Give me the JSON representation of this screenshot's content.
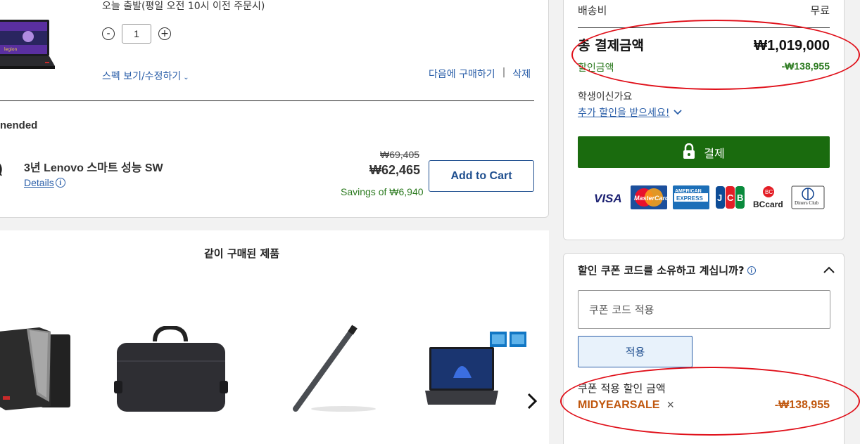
{
  "cart_item": {
    "ship_note": "오늘 출발(평일 오전 10시 이전 주문시)",
    "quantity": "1",
    "minus": "-",
    "plus": "+",
    "spec_link": "스펙 보기/수정하기",
    "save_later": "다음에 구매하기",
    "separator": "|",
    "delete": "삭제",
    "icon": "chevron-down-icon"
  },
  "recommended": {
    "heading_fragment": "nended",
    "product_name": "3년 Lenovo 스마트 성능 SW",
    "details_label": "Details",
    "original_price": "₩69,405",
    "price": "₩62,465",
    "savings": "Savings of ₩6,940",
    "add_to_cart": "Add to Cart"
  },
  "bought_together": {
    "title": "같이 구매된 제품",
    "products": [
      {
        "icon": "laptop-sleeve-image"
      },
      {
        "icon": "laptop-bag-image"
      },
      {
        "icon": "stylus-pen-image"
      },
      {
        "icon": "gaming-laptop-image"
      }
    ],
    "next_icon": "chevron-right-icon"
  },
  "summary": {
    "shipping_label": "배송비",
    "shipping_value": "무료",
    "total_label": "총 결제금액",
    "total_value": "₩1,019,000",
    "discount_label": "할인금액",
    "discount_value": "-₩138,955",
    "student_question": "학생이신가요",
    "student_link": "추가 할인을 받으세요!",
    "checkout_label": "결제",
    "payment_methods": [
      "VISA",
      "MasterCard",
      "AMERICAN EXPRESS",
      "JCB",
      "BCcard",
      "Diners Club"
    ]
  },
  "coupon": {
    "question": "할인 쿠폰 코드를 소유하고 계십니까?",
    "input_placeholder": "쿠폰 코드 적용",
    "apply_label": "적용",
    "applied_label": "쿠폰 적용 할인 금액",
    "code": "MIDYEARSALE",
    "remove": "×",
    "code_value": "-₩138,955"
  },
  "colors": {
    "accent_blue": "#2a5ea8",
    "checkout_green": "#1a6b0e",
    "discount_green": "#2b7a1f",
    "coupon_orange": "#c0570e",
    "annotation_red": "#e0101a"
  }
}
